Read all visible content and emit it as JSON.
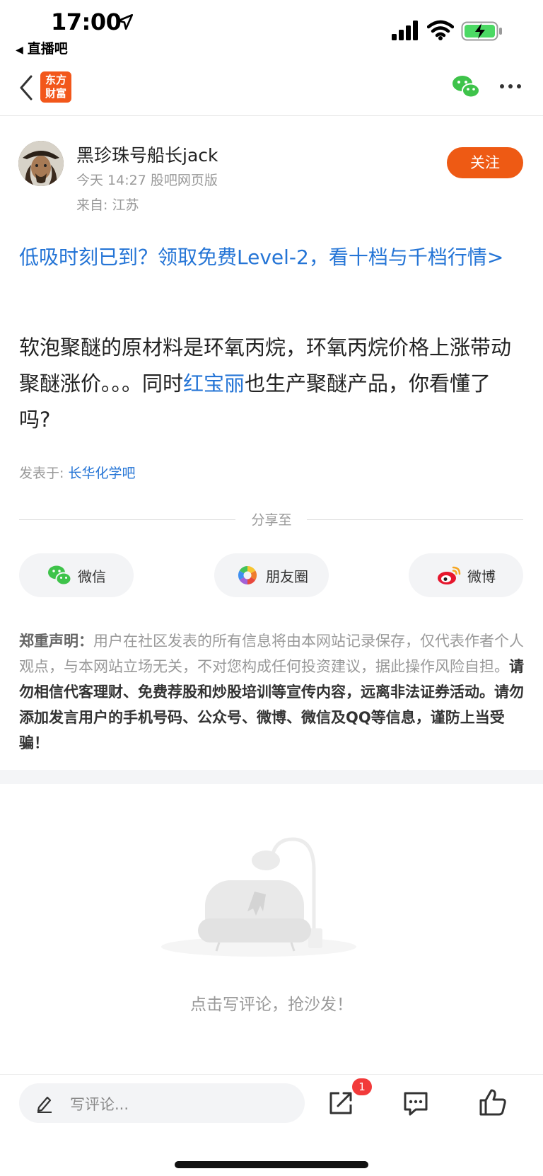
{
  "status_bar": {
    "time": "17:00",
    "back_app": "直播吧"
  },
  "nav": {
    "logo_text": "东方财富"
  },
  "author": {
    "name": "黑珍珠号船长jack",
    "time": "今天 14:27 股吧网页版",
    "location": "来自: 江苏",
    "follow_label": "关注"
  },
  "promo": {
    "text": "低吸时刻已到？领取免费Level-2，看十档与千档行情>"
  },
  "post": {
    "text_before": "软泡聚醚的原材料是环氧丙烷，环氧丙烷价格上涨带动聚醚涨价。。。同时",
    "stock_link": "红宝丽",
    "text_after": "也生产聚醚产品，你看懂了吗?"
  },
  "posted_in": {
    "label": "发表于:",
    "bar_name": "长华化学吧"
  },
  "share": {
    "title": "分享至",
    "options": [
      {
        "label": "微信",
        "icon": "wechat-icon"
      },
      {
        "label": "朋友圈",
        "icon": "moments-icon"
      },
      {
        "label": "微博",
        "icon": "weibo-icon"
      }
    ]
  },
  "disclaimer": {
    "label": "郑重声明：",
    "normal": "用户在社区发表的所有信息将由本网站记录保存，仅代表作者个人观点，与本网站立场无关，不对您构成任何投资建议，据此操作风险自担。",
    "bold": "请勿相信代客理财、免费荐股和炒股培训等宣传内容，远离非法证券活动。请勿添加发言用户的手机号码、公众号、微博、微信及QQ等信息，谨防上当受骗！"
  },
  "comments": {
    "empty_text": "点击写评论，抢沙发！"
  },
  "bottom_bar": {
    "input_placeholder": "写评论...",
    "share_badge": "1"
  },
  "colors": {
    "accent_blue": "#2575d6",
    "follow_orange": "#ee5a14",
    "logo_orange": "#f2571b",
    "badge_red": "#f23a3a"
  }
}
